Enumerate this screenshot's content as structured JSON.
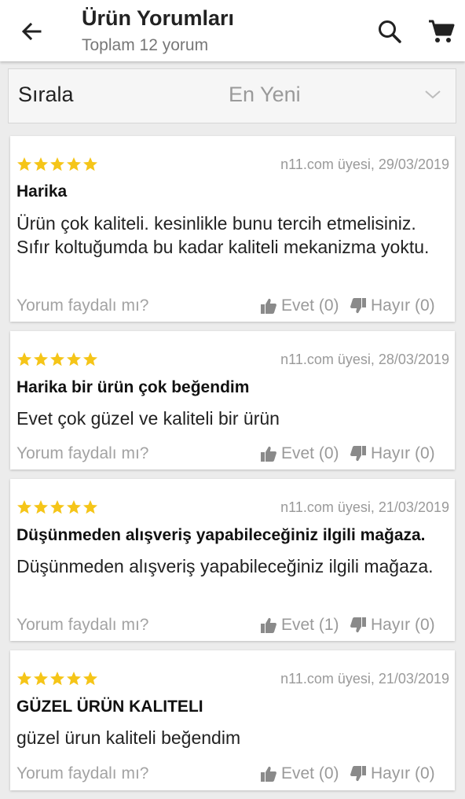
{
  "header": {
    "title": "Ürün Yorumları",
    "subtitle": "Toplam 12 yorum",
    "icons": [
      "arrow-left-icon",
      "search-icon",
      "cart-icon"
    ]
  },
  "sort": {
    "label": "Sırala",
    "selected": "En Yeni"
  },
  "colors": {
    "star": "#f5c518",
    "accent_text": "#222222",
    "muted_text": "#9a9a9a"
  },
  "reviews": [
    {
      "rating": 5,
      "meta": "n11.com üyesi, 29/03/2019",
      "title": "Harika",
      "body": "Ürün çok kaliteli. kesinlikle bunu tercih etmelisiniz. Sıfır koltuğumda bu kadar kaliteli mekanizma yoktu.",
      "helpful_prompt": "Yorum faydalı mı?",
      "yes": "Evet (0)",
      "no": "Hayır (0)"
    },
    {
      "rating": 5,
      "meta": "n11.com üyesi, 28/03/2019",
      "title": "Harika bir ürün çok beğendim",
      "body": "Evet çok güzel ve kaliteli bir ürün",
      "helpful_prompt": "Yorum faydalı mı?",
      "yes": "Evet (0)",
      "no": "Hayır (0)"
    },
    {
      "rating": 5,
      "meta": "n11.com üyesi, 21/03/2019",
      "title": "Düşünmeden alışveriş yapabileceğiniz ilgili mağaza.",
      "body": "Düşünmeden alışveriş yapabileceğiniz ilgili mağaza.",
      "helpful_prompt": "Yorum faydalı mı?",
      "yes": "Evet (1)",
      "no": "Hayır (0)"
    },
    {
      "rating": 5,
      "meta": "n11.com üyesi, 21/03/2019",
      "title": "GÜZEL ÜRÜN  KALITELI",
      "body": "güzel ürun kaliteli beğendim",
      "helpful_prompt": "Yorum faydalı mı?",
      "yes": "Evet (0)",
      "no": "Hayır (0)"
    }
  ]
}
